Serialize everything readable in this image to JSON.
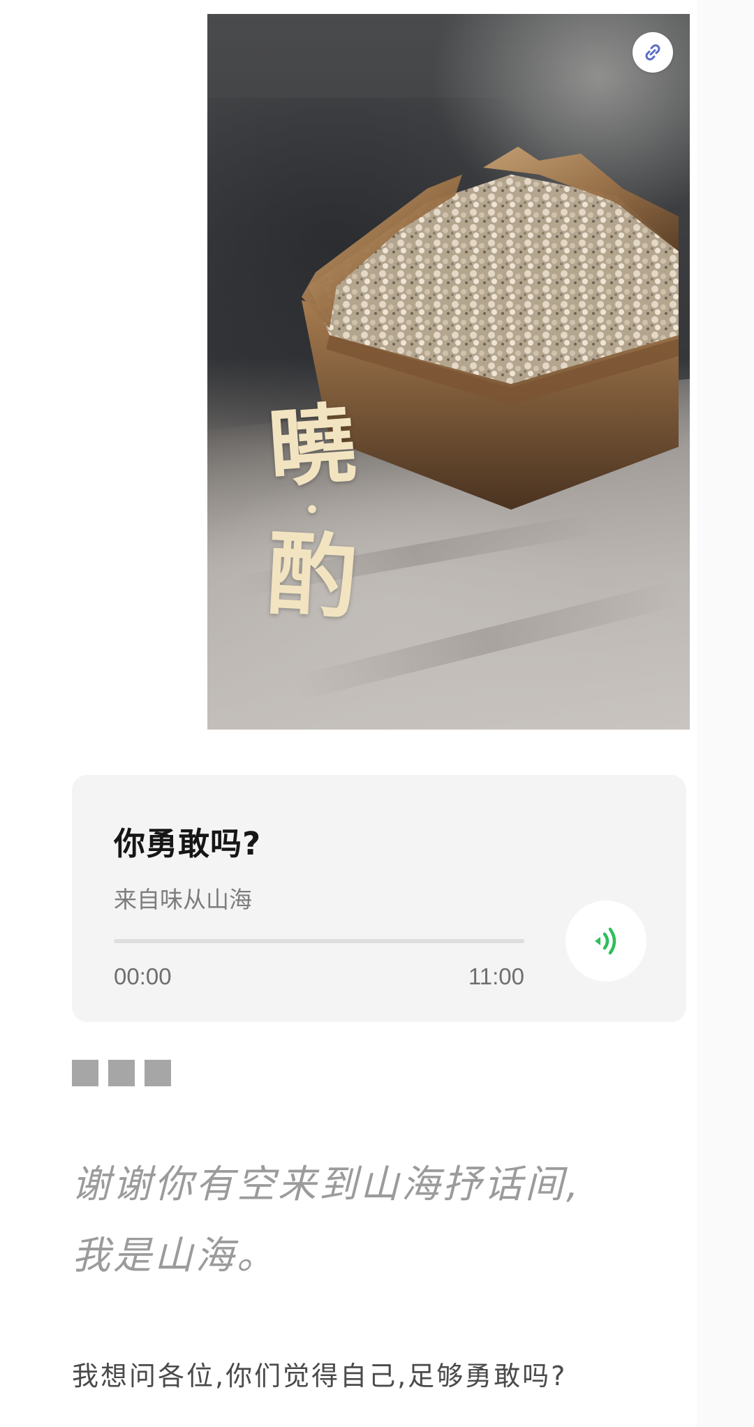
{
  "cover": {
    "calligraphy_first": "曉",
    "calligraphy_dot": "·",
    "calligraphy_second": "酌",
    "link_badge_icon": "link-icon"
  },
  "audio": {
    "title": "你勇敢吗?",
    "source": "来自味从山海",
    "current_time": "00:00",
    "total_time": "11:00",
    "progress_fraction": 0,
    "play_icon": "sound-wave-icon",
    "accent_color": "#2dbf5a"
  },
  "body": {
    "intro_line1": "谢谢你有空来到山海抒话间,",
    "intro_line2": "我是山海。",
    "question": "我想问各位,你们觉得自己,足够勇敢吗?"
  }
}
